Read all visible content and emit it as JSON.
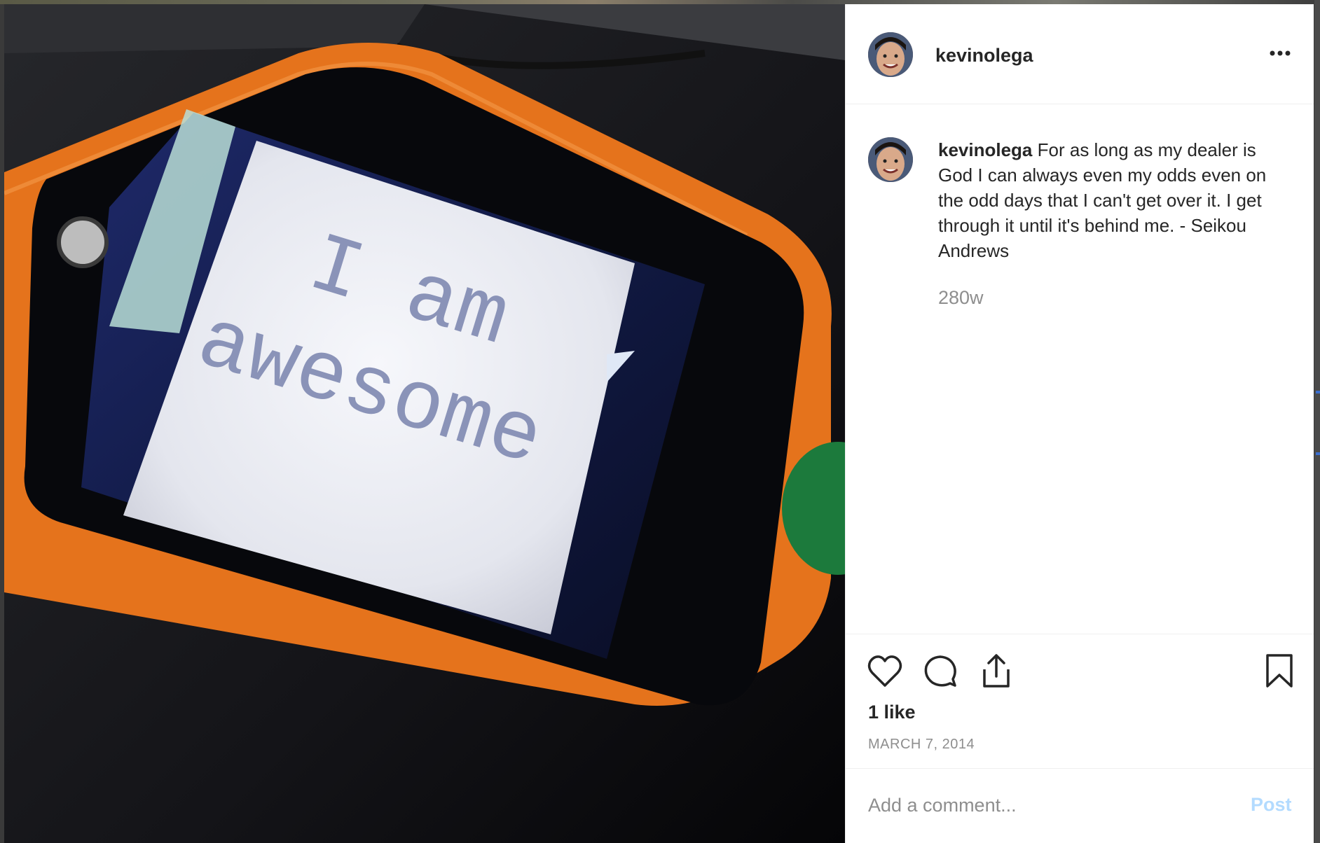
{
  "post": {
    "username": "kevinolega",
    "caption_username": "kevinolega",
    "caption_text": "For as long as my dealer is God I can always even my odds even on the odd days that I can't get over it. I get through it until it's behind me. - Seikou Andrews",
    "time_ago": "280w",
    "likes": "1 like",
    "date": "MARCH 7, 2014"
  },
  "photo": {
    "line1": "I am",
    "line2": "awesome"
  },
  "comment_box": {
    "placeholder": "Add a comment...",
    "post_label": "Post"
  },
  "icons": {
    "more": "more-options-icon",
    "like": "heart-icon",
    "comment": "comment-bubble-icon",
    "share": "share-icon",
    "save": "bookmark-icon"
  },
  "colors": {
    "text": "#262626",
    "muted": "#8e8e8e",
    "post_button_disabled": "#b3dbff",
    "device_orange": "#e5731c"
  }
}
